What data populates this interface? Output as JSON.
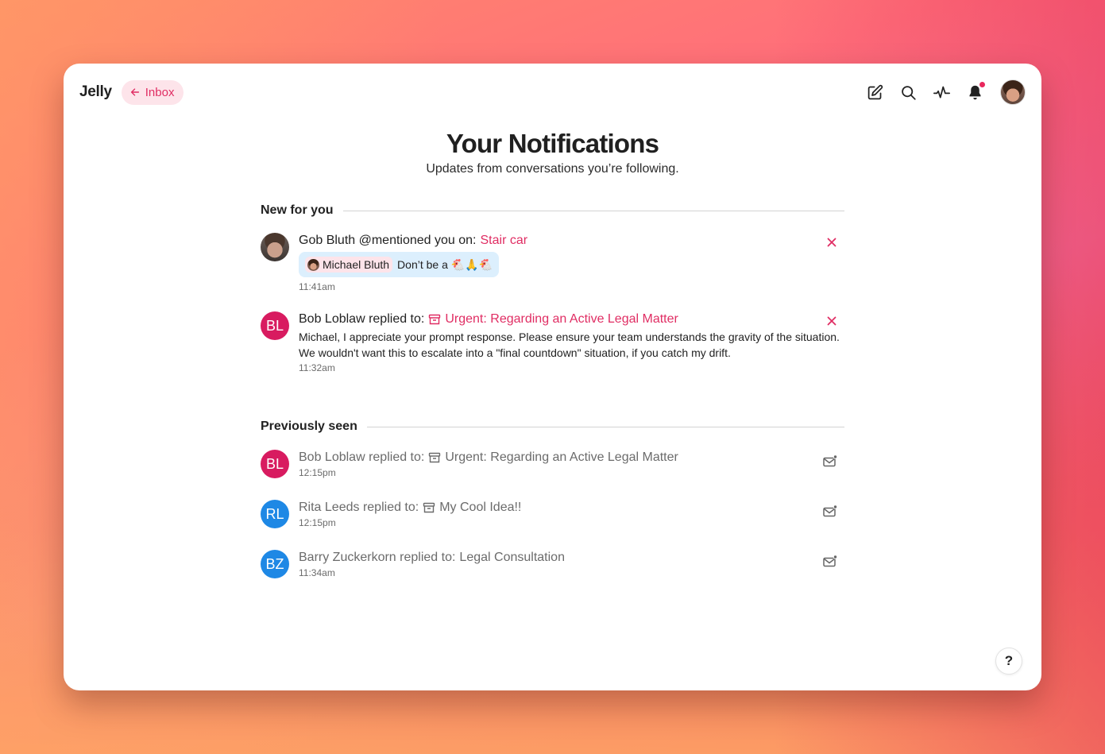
{
  "app": {
    "name": "Jelly"
  },
  "nav": {
    "back_label": "Inbox"
  },
  "toolbar": {
    "icons": [
      "compose-icon",
      "search-icon",
      "activity-icon",
      "bell-icon"
    ],
    "has_unread_badge": true,
    "badge_color": "#e9285d"
  },
  "header": {
    "title": "Your Notifications",
    "subtitle": "Updates from conversations you’re following."
  },
  "new_section": {
    "title": "New for you",
    "items": [
      {
        "actor": "Gob Bluth",
        "action": "@mentioned you on:",
        "target": "Stair car",
        "target_archived": false,
        "quote_mention": "Michael Bluth",
        "quote_text": "Don’t be a 🐔🙏🐔",
        "time": "11:41am"
      },
      {
        "actor": "Bob Loblaw",
        "initials": "BL",
        "avatar_color": "#d81b60",
        "action": "replied to:",
        "target": "Urgent: Regarding an Active Legal Matter",
        "target_archived": true,
        "text": "Michael, I appreciate your prompt response. Please ensure your team understands the gravity of the situation. We wouldn't want this to escalate into a \"final countdown\" situation, if you catch my drift.",
        "time": "11:32am"
      }
    ]
  },
  "seen_section": {
    "title": "Previously seen",
    "items": [
      {
        "actor": "Bob Loblaw",
        "initials": "BL",
        "avatar_color": "#d81b60",
        "action": "replied to:",
        "target": "Urgent: Regarding an Active Legal Matter",
        "target_archived": true,
        "time": "12:15pm"
      },
      {
        "actor": "Rita Leeds",
        "initials": "RL",
        "avatar_color": "#1e88e5",
        "action": "replied to:",
        "target": "My Cool Idea!!",
        "target_archived": true,
        "time": "12:15pm"
      },
      {
        "actor": "Barry Zuckerkorn",
        "initials": "BZ",
        "avatar_color": "#1e88e5",
        "action": "replied to:",
        "target": "Legal Consultation",
        "target_archived": false,
        "time": "11:34am"
      }
    ]
  },
  "help": {
    "label": "?"
  },
  "colors": {
    "accent": "#e02d63",
    "accent_bg": "#fde4ea",
    "quote_bg": "#dceffd"
  }
}
